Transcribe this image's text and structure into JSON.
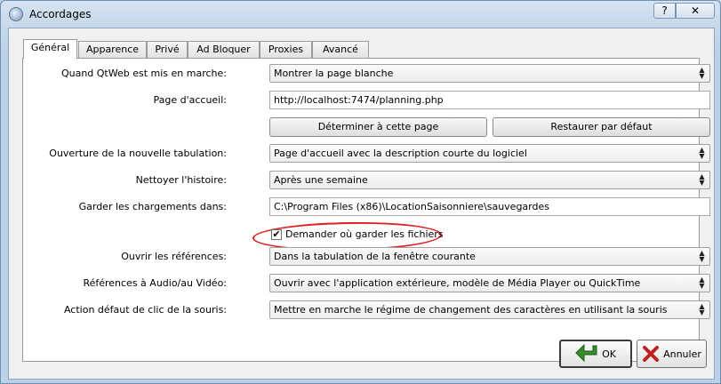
{
  "window": {
    "title": "Accordages",
    "help_label": "?",
    "close_label": "✕"
  },
  "tabs": [
    {
      "label": "Général"
    },
    {
      "label": "Apparence"
    },
    {
      "label": "Privé"
    },
    {
      "label": "Ad Bloquer"
    },
    {
      "label": "Proxies"
    },
    {
      "label": "Avancé"
    }
  ],
  "general": {
    "startup": {
      "label": "Quand QtWeb est mis en marche:",
      "value": "Montrer la page blanche"
    },
    "homepage": {
      "label": "Page d'accueil:",
      "value": "http://localhost:7474/planning.php"
    },
    "set_current_label": "Déterminer à cette page",
    "restore_default_label": "Restaurer par défaut",
    "new_tab": {
      "label": "Ouverture de la nouvelle tabulation:",
      "value": "Page d'accueil avec la description courte du logiciel"
    },
    "clear_history": {
      "label": "Nettoyer l'histoire:",
      "value": "Après une semaine"
    },
    "downloads": {
      "label": "Garder les chargements dans:",
      "value": "C:\\Program Files (x86)\\LocationSaisonniere\\sauvegardes"
    },
    "ask_download": {
      "label": "Demander où garder les fichiers",
      "checked": true
    },
    "open_links": {
      "label": "Ouvrir les références:",
      "value": "Dans la tabulation de la fenêtre courante"
    },
    "audio_video": {
      "label": "Références à Audio/au Vidéo:",
      "value": "Ouvrir avec l'application extérieure, modèle de Média Player ou QuickTime"
    },
    "mouse_click": {
      "label": "Action défaut de clic de la souris:",
      "value": "Mettre en marche le régime de changement des caractères en utilisant la souris"
    }
  },
  "buttons": {
    "ok_label": "OK",
    "cancel_label": "Annuler"
  },
  "colors": {
    "annotation": "#e02020",
    "ok_arrow": "#3a8a2e",
    "cancel_x": "#c02020"
  },
  "icons": {
    "app": "globe-icon",
    "ok": "green-arrow-icon",
    "cancel": "red-x-icon"
  }
}
